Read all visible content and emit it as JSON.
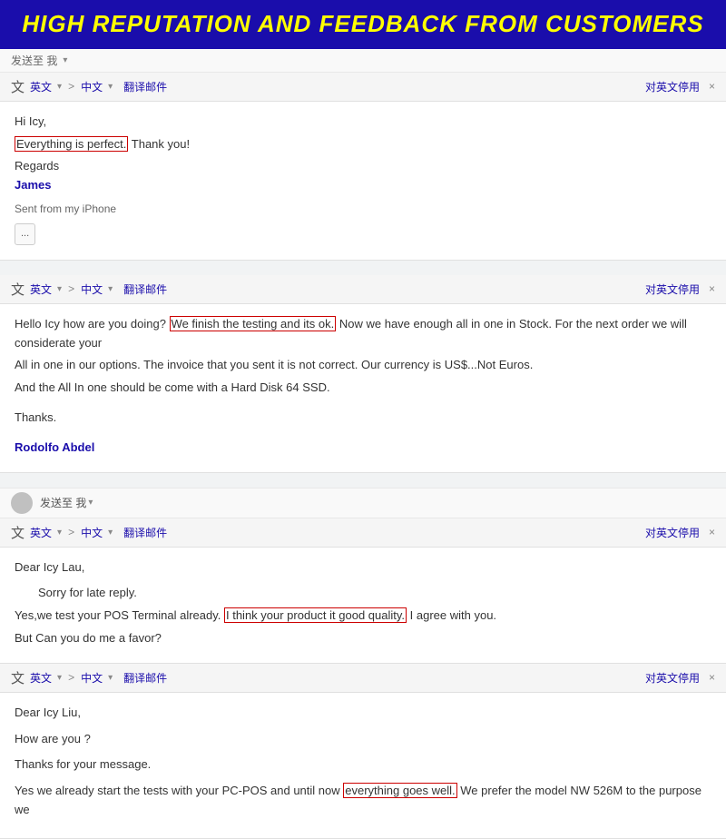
{
  "banner": {
    "text": "HIGH REPUTATION AND FEEDBACK FROM CUSTOMERS"
  },
  "email1": {
    "send_to": "发送至 我",
    "translate_bar": {
      "lang_icon": "文",
      "from_lang": "英文",
      "arrow": ">",
      "to_lang": "中文",
      "translate_btn": "翻译邮件",
      "disable_btn": "对英文停用",
      "close": "×"
    },
    "body": {
      "greeting": "Hi Icy,",
      "line1_before": "",
      "line1_highlight": "Everything is perfect.",
      "line1_after": " Thank you!",
      "line2": "Regards",
      "sender": "James",
      "line3": "Sent from my iPhone",
      "ellipsis": "..."
    }
  },
  "email2": {
    "translate_bar": {
      "lang_icon": "文",
      "from_lang": "英文",
      "arrow": ">",
      "to_lang": "中文",
      "translate_btn": "翻译邮件",
      "disable_btn": "对英文停用",
      "close": "×"
    },
    "body": {
      "line1_before": "Hello Icy how are you doing? ",
      "line1_highlight": "We finish the testing and its ok.",
      "line1_after": " Now we have enough all in one in Stock. For the next order we will considerate your",
      "line2": "All in one in our options. The invoice that you sent it is not correct. Our currency is US$...Not Euros.",
      "line3": "And the All In one should be come with a  Hard Disk 64 SSD.",
      "line4": "",
      "thanks": "Thanks.",
      "line5": "",
      "sender": "Rodolfo Abdel"
    }
  },
  "email3": {
    "send_to": "发送至 我",
    "translate_bar": {
      "lang_icon": "文",
      "from_lang": "英文",
      "arrow": ">",
      "to_lang": "中文",
      "translate_btn": "翻译邮件",
      "disable_btn": "对英文停用",
      "close": "×"
    },
    "body": {
      "greeting": "Dear Icy Lau,",
      "line1": "",
      "sorry": "Sorry for late reply.",
      "line2_before": "Yes,we test  your POS Terminal already. ",
      "line2_highlight": "I think your product it good quality.",
      "line2_after": " I agree with you.",
      "line3": "But Can you do me a favor?"
    }
  },
  "email4": {
    "translate_bar": {
      "lang_icon": "文",
      "from_lang": "英文",
      "arrow": ">",
      "to_lang": "中文",
      "translate_btn": "翻译邮件",
      "disable_btn": "对英文停用",
      "close": "×"
    },
    "body": {
      "greeting": "Dear Icy Liu,",
      "line1": "",
      "how_are": "How are you ?",
      "line2": "",
      "thanks_msg": "Thanks for your message.",
      "line3": "",
      "line4_before": "Yes we already start the tests with your PC-POS and until now ",
      "line4_highlight": "everything goes well.",
      "line4_after": " We prefer the model NW 526M to the purpose we"
    }
  }
}
